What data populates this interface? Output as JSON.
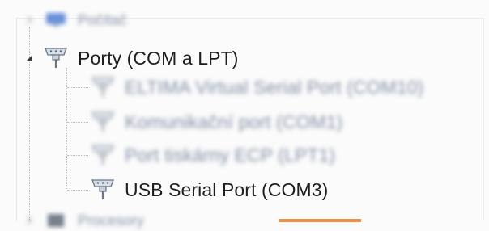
{
  "device_tree": {
    "top_partial": {
      "label": "Počítač",
      "icon": "computer-icon"
    },
    "ports_category": {
      "label": "Porty (COM a LPT)",
      "icon": "port-connector-icon",
      "expanded": true,
      "children": [
        {
          "label": "ELTIMA Virtual Serial Port (COM10)",
          "icon": "port-connector-icon",
          "blurred": true
        },
        {
          "label": "Komunikační port (COM1)",
          "icon": "port-connector-icon",
          "blurred": true
        },
        {
          "label": "Port tiskárny ECP (LPT1)",
          "icon": "port-connector-icon",
          "blurred": true
        },
        {
          "label": "USB Serial Port (COM3)",
          "icon": "port-connector-icon",
          "blurred": false
        }
      ]
    },
    "bottom_partial": {
      "label": "Procesory",
      "icon": "processor-icon"
    }
  },
  "colors": {
    "accent_underline": "#f09040",
    "tree_lines": "#b9b9b9",
    "text": "#1e1e1e"
  }
}
